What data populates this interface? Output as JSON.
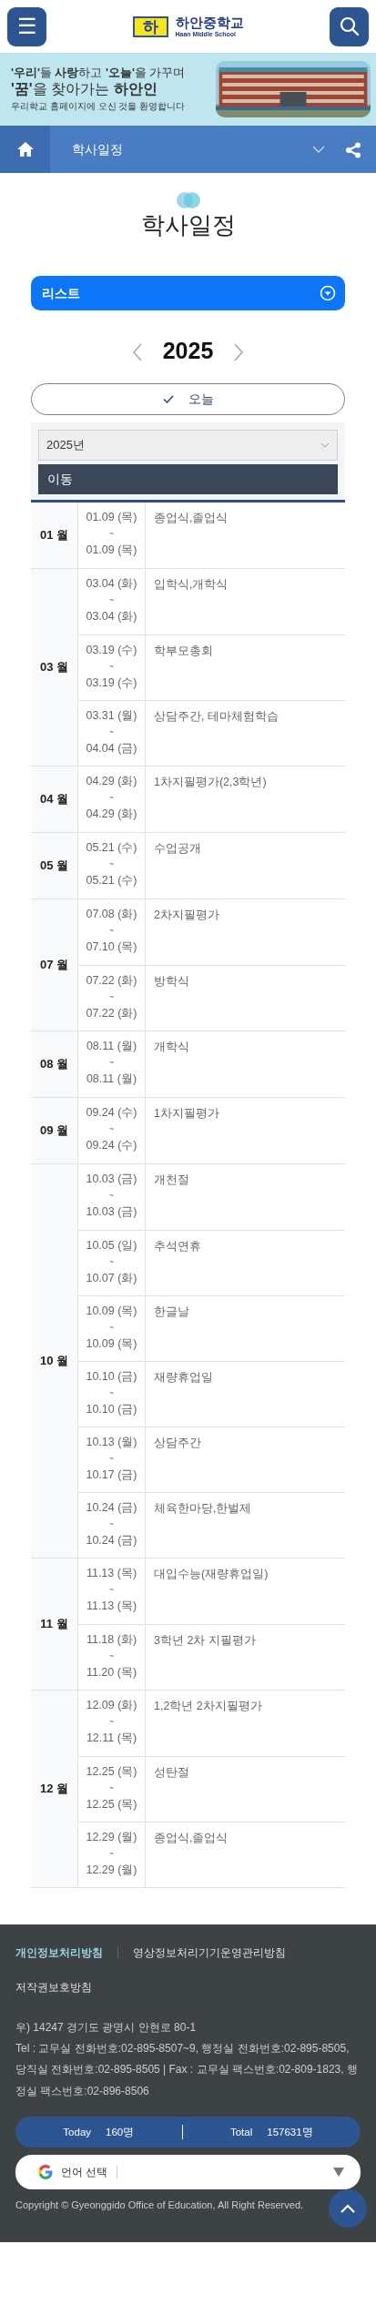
{
  "header": {
    "menu_label": "☰",
    "logo_mark": "하",
    "school_name": "하안중학교",
    "school_name_en": "Haan Middle School"
  },
  "banner": {
    "lines": [
      "**'우리'**들 **사랑**하고 **'오늘'**을 가꾸며",
      "**'꿈'**을 찾아가는 **하안인**"
    ],
    "caption": "우리학교 홈페이지에 오신 것을 환영합니다",
    "photo": {
      "kind": "picture"
    }
  },
  "breadcrumb": {
    "current": "학사일정"
  },
  "page_title": "학사일정",
  "view_toggle": {
    "label": "리스트"
  },
  "year_nav": {
    "year": "2025"
  },
  "today_button": {
    "label": "오늘"
  },
  "year_select": {
    "value": "2025년"
  },
  "move_button": {
    "label": "이동"
  },
  "months": [
    {
      "month": "01 월",
      "events": [
        {
          "start": "01.09 (목)",
          "range_mark": "~",
          "end": "01.09 (목)",
          "title": "종업식,졸업식"
        }
      ]
    },
    {
      "month": "03 월",
      "events": [
        {
          "start": "03.04 (화)",
          "range_mark": "~",
          "end": "03.04 (화)",
          "title": "입학식,개학식"
        },
        {
          "start": "03.19 (수)",
          "range_mark": "~",
          "end": "03.19 (수)",
          "title": "학부모총회"
        },
        {
          "start": "03.31 (월)",
          "range_mark": "~",
          "end": "04.04 (금)",
          "title": "상담주간, 테마체험학습"
        }
      ]
    },
    {
      "month": "04 월",
      "events": [
        {
          "start": "04.29 (화)",
          "range_mark": "~",
          "end": "04.29 (화)",
          "title": "1차지필평가(2,3학년)"
        }
      ]
    },
    {
      "month": "05 월",
      "events": [
        {
          "start": "05.21 (수)",
          "range_mark": "~",
          "end": "05.21 (수)",
          "title": "수업공개"
        }
      ]
    },
    {
      "month": "07 월",
      "events": [
        {
          "start": "07.08 (화)",
          "range_mark": "~",
          "end": "07.10 (목)",
          "title": "2차지필평가"
        },
        {
          "start": "07.22 (화)",
          "range_mark": "~",
          "end": "07.22 (화)",
          "title": "방학식"
        }
      ]
    },
    {
      "month": "08 월",
      "events": [
        {
          "start": "08.11 (월)",
          "range_mark": "~",
          "end": "08.11 (월)",
          "title": "개학식"
        }
      ]
    },
    {
      "month": "09 월",
      "events": [
        {
          "start": "09.24 (수)",
          "range_mark": "~",
          "end": "09.24 (수)",
          "title": "1차지필평가"
        }
      ]
    },
    {
      "month": "10 월",
      "events": [
        {
          "start": "10.03 (금)",
          "range_mark": "~",
          "end": "10.03 (금)",
          "title": "개천절"
        },
        {
          "start": "10.05 (일)",
          "range_mark": "~",
          "end": "10.07 (화)",
          "title": "추석연휴"
        },
        {
          "start": "10.09 (목)",
          "range_mark": "~",
          "end": "10.09 (목)",
          "title": "한글날"
        },
        {
          "start": "10.10 (금)",
          "range_mark": "~",
          "end": "10.10 (금)",
          "title": "재량휴업일"
        },
        {
          "start": "10.13 (월)",
          "range_mark": "~",
          "end": "10.17 (금)",
          "title": "상담주간"
        },
        {
          "start": "10.24 (금)",
          "range_mark": "~",
          "end": "10.24 (금)",
          "title": "체육한마당,한벌제"
        }
      ]
    },
    {
      "month": "11 월",
      "events": [
        {
          "start": "11.13 (목)",
          "range_mark": "~",
          "end": "11.13 (목)",
          "title": "대입수능(재량휴업일)"
        },
        {
          "start": "11.18 (화)",
          "range_mark": "~",
          "end": "11.20 (목)",
          "title": "3학년 2차 지필평가"
        }
      ]
    },
    {
      "month": "12 월",
      "events": [
        {
          "start": "12.09 (화)",
          "range_mark": "~",
          "end": "12.11 (목)",
          "title": "1,2학년 2차지필평가"
        },
        {
          "start": "12.25 (목)",
          "range_mark": "~",
          "end": "12.25 (목)",
          "title": "성탄절"
        },
        {
          "start": "12.29 (월)",
          "range_mark": "~",
          "end": "12.29 (월)",
          "title": "종업식,졸업식"
        }
      ]
    }
  ],
  "footer": {
    "policy_links": [
      {
        "label": "개인정보처리방침",
        "emphasized": true
      },
      {
        "label": "영상정보처리기기운영관리방침",
        "emphasized": false
      },
      {
        "label": "저작권보호방침",
        "emphasized": false
      }
    ],
    "address": "우) 14247 경기도 광명시 안현로 80-1",
    "contacts": "Tel : 교무실 전화번호:02-895-8507~9, 행정실 전화번호:02-895-8505, 당직실 전화번호:02-895-8505 | Fax : 교무실 팩스번호:02-809-1823, 행정실 팩스번호:02-896-8506",
    "visitors": {
      "today_label": "Today",
      "today_count": "160명",
      "total_label": "Total",
      "total_count": "157631명"
    },
    "language_select": {
      "label": "언어 선택"
    },
    "copyright": "Copyright © Gyeonggido Office of Education, All Right Reserved."
  }
}
